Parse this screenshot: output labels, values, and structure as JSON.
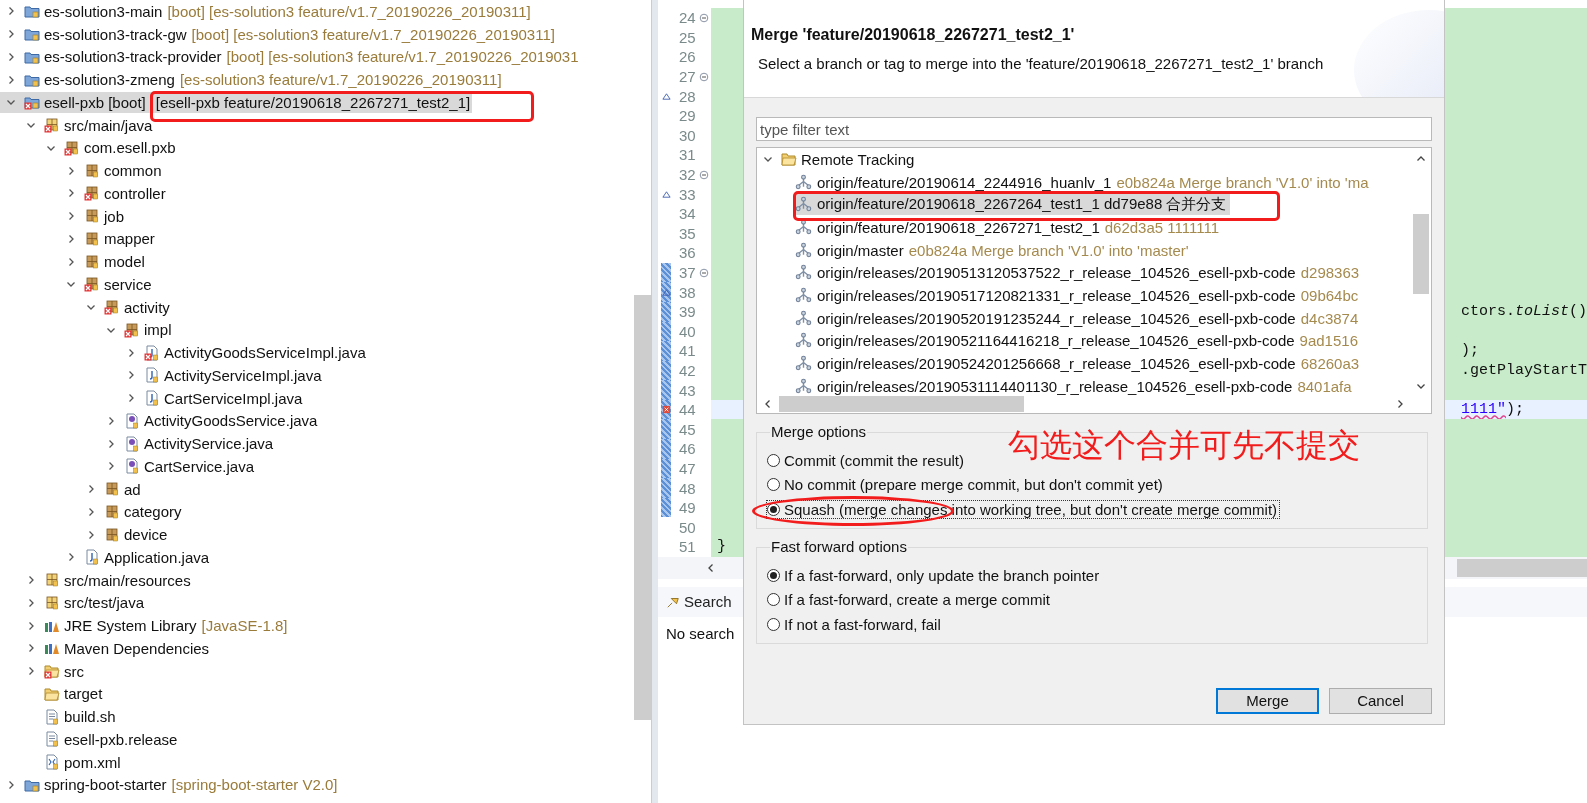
{
  "project_explorer": {
    "tree": [
      {
        "label": "es-solution3-main",
        "detail": "[boot] [es-solution3 feature/v1.7_20190226_20190311]",
        "kind": "project",
        "error": false,
        "expanded": false,
        "selected": false
      },
      {
        "label": "es-solution3-track-gw",
        "detail": "[boot] [es-solution3 feature/v1.7_20190226_20190311]",
        "kind": "project",
        "error": false,
        "expanded": false,
        "selected": false
      },
      {
        "label": "es-solution3-track-provider",
        "detail": "[boot] [es-solution3 feature/v1.7_20190226_2019031",
        "kind": "project",
        "error": false,
        "expanded": false,
        "selected": false
      },
      {
        "label": "es-solution3-zmeng",
        "detail": "[es-solution3 feature/v1.7_20190226_20190311]",
        "kind": "project",
        "error": false,
        "expanded": false,
        "selected": false
      },
      {
        "label": "esell-pxb [boot]",
        "detail": "[esell-pxb feature/20190618_2267271_test2_1]",
        "kind": "project",
        "error": true,
        "expanded": true,
        "selected": true,
        "children": [
          {
            "label": "src/main/java",
            "kind": "source-folder",
            "error": true,
            "expanded": true,
            "selected": false,
            "children": [
              {
                "label": "com.esell.pxb",
                "kind": "package",
                "error": true,
                "expanded": true,
                "selected": false,
                "children": [
                  {
                    "label": "common",
                    "kind": "package",
                    "error": false,
                    "expanded": false,
                    "selected": false
                  },
                  {
                    "label": "controller",
                    "kind": "package",
                    "error": true,
                    "expanded": false,
                    "selected": false
                  },
                  {
                    "label": "job",
                    "kind": "package",
                    "error": false,
                    "expanded": false,
                    "selected": false
                  },
                  {
                    "label": "mapper",
                    "kind": "package",
                    "error": false,
                    "expanded": false,
                    "selected": false
                  },
                  {
                    "label": "model",
                    "kind": "package",
                    "error": false,
                    "expanded": false,
                    "selected": false
                  },
                  {
                    "label": "service",
                    "kind": "package",
                    "error": true,
                    "expanded": true,
                    "selected": false,
                    "children": [
                      {
                        "label": "activity",
                        "kind": "package",
                        "error": true,
                        "expanded": true,
                        "selected": false,
                        "children": [
                          {
                            "label": "impl",
                            "kind": "package",
                            "error": true,
                            "expanded": true,
                            "selected": false,
                            "children": [
                              {
                                "label": "ActivityGoodsServiceImpl.java",
                                "kind": "java",
                                "error": true,
                                "expanded": false,
                                "selected": false
                              },
                              {
                                "label": "ActivityServiceImpl.java",
                                "kind": "java",
                                "error": false,
                                "expanded": false,
                                "selected": false
                              },
                              {
                                "label": "CartServiceImpl.java",
                                "kind": "java",
                                "error": false,
                                "expanded": false,
                                "selected": false
                              }
                            ]
                          },
                          {
                            "label": "ActivityGoodsService.java",
                            "kind": "interface",
                            "error": false,
                            "expanded": false,
                            "selected": false
                          },
                          {
                            "label": "ActivityService.java",
                            "kind": "interface",
                            "error": false,
                            "expanded": false,
                            "selected": false
                          },
                          {
                            "label": "CartService.java",
                            "kind": "interface",
                            "error": false,
                            "expanded": false,
                            "selected": false
                          }
                        ]
                      },
                      {
                        "label": "ad",
                        "kind": "package",
                        "error": false,
                        "expanded": false,
                        "selected": false
                      },
                      {
                        "label": "category",
                        "kind": "package",
                        "error": false,
                        "expanded": false,
                        "selected": false
                      },
                      {
                        "label": "device",
                        "kind": "package",
                        "error": false,
                        "expanded": false,
                        "selected": false
                      }
                    ]
                  },
                  {
                    "label": "Application.java",
                    "kind": "java",
                    "error": false,
                    "expanded": false,
                    "selected": false
                  }
                ]
              }
            ]
          },
          {
            "label": "src/main/resources",
            "kind": "source-folder",
            "error": false,
            "expanded": false,
            "selected": false
          },
          {
            "label": "src/test/java",
            "kind": "source-folder",
            "error": false,
            "expanded": false,
            "selected": false
          },
          {
            "label": "JRE System Library",
            "detail": "[JavaSE-1.8]",
            "kind": "library",
            "error": false,
            "expanded": false,
            "selected": false
          },
          {
            "label": "Maven Dependencies",
            "kind": "library",
            "error": false,
            "expanded": false,
            "selected": false
          },
          {
            "label": "src",
            "kind": "folder",
            "error": true,
            "expanded": false,
            "selected": false
          },
          {
            "label": "target",
            "kind": "folder",
            "error": false,
            "selected": false
          },
          {
            "label": "build.sh",
            "kind": "file",
            "error": false,
            "selected": false
          },
          {
            "label": "esell-pxb.release",
            "kind": "file",
            "error": false,
            "selected": false
          },
          {
            "label": "pom.xml",
            "kind": "xml",
            "error": false,
            "selected": false
          }
        ]
      },
      {
        "label": "spring-boot-starter",
        "detail": "[spring-boot-starter V2.0]",
        "kind": "project",
        "error": false,
        "expanded": false,
        "selected": false
      }
    ]
  },
  "editor": {
    "lines": [
      {
        "number": "24",
        "fold": true,
        "changed": false,
        "current": false
      },
      {
        "number": "25",
        "fold": false,
        "changed": false,
        "current": false
      },
      {
        "number": "26",
        "fold": false,
        "changed": false,
        "current": false
      },
      {
        "number": "27",
        "fold": true,
        "changed": false,
        "current": false
      },
      {
        "number": "28",
        "fold": false,
        "changed": false,
        "current": false,
        "kind": "override"
      },
      {
        "number": "29",
        "fold": false,
        "changed": false,
        "current": false
      },
      {
        "number": "30",
        "fold": false,
        "changed": false,
        "current": false
      },
      {
        "number": "31",
        "fold": false,
        "changed": false,
        "current": false
      },
      {
        "number": "32",
        "fold": true,
        "changed": false,
        "current": false
      },
      {
        "number": "33",
        "fold": false,
        "changed": false,
        "current": false,
        "kind": "override"
      },
      {
        "number": "34",
        "fold": false,
        "changed": false,
        "current": false
      },
      {
        "number": "35",
        "fold": false,
        "changed": false,
        "current": false
      },
      {
        "number": "36",
        "fold": false,
        "changed": false,
        "current": false
      },
      {
        "number": "37",
        "fold": true,
        "changed": true,
        "current": false
      },
      {
        "number": "38",
        "fold": false,
        "changed": true,
        "current": false,
        "kind": "override"
      },
      {
        "number": "39",
        "fold": false,
        "changed": true,
        "current": false,
        "tail": [
          {
            "kind": "code",
            "text": "ctors.*toList*()"
          }
        ]
      },
      {
        "number": "40",
        "fold": false,
        "changed": true,
        "current": false
      },
      {
        "number": "41",
        "fold": false,
        "changed": true,
        "current": false,
        "tail": [
          {
            "kind": "code",
            "text": ");"
          }
        ]
      },
      {
        "number": "42",
        "fold": false,
        "changed": true,
        "current": false,
        "tail": [
          {
            "kind": "code",
            "text": ".getPlayStartT"
          }
        ]
      },
      {
        "number": "43",
        "fold": false,
        "changed": true,
        "current": false
      },
      {
        "number": "44",
        "fold": false,
        "changed": true,
        "current": true,
        "kind": "error",
        "tail": [
          {
            "kind": "string",
            "text": "1111\""
          },
          {
            "kind": "code",
            "text": ");"
          }
        ]
      },
      {
        "number": "45",
        "fold": false,
        "changed": true,
        "current": false
      },
      {
        "number": "46",
        "fold": false,
        "changed": true,
        "current": false
      },
      {
        "number": "47",
        "fold": false,
        "changed": true,
        "current": false
      },
      {
        "number": "48",
        "fold": false,
        "changed": true,
        "current": false
      },
      {
        "number": "49",
        "fold": false,
        "changed": true,
        "current": false
      },
      {
        "number": "50",
        "fold": false,
        "changed": false,
        "current": false
      },
      {
        "number": "51",
        "fold": false,
        "changed": false,
        "current": false,
        "code": "}"
      }
    ]
  },
  "search_view": {
    "tab": "Search",
    "message": "No search"
  },
  "merge_dialog": {
    "title": "Merge 'feature/20190618_2267271_test2_1'",
    "message": "Select a branch or tag to merge into the 'feature/20190618_2267271_test2_1' branch",
    "filter": {
      "placeholder": "type filter text"
    },
    "refs": {
      "label": "Remote Tracking",
      "expanded": true,
      "items": [
        {
          "name": "origin/feature/20190614_2244916_huanlv_1",
          "detail": "e0b824a Merge branch 'V1.0' into 'ma",
          "selected": false
        },
        {
          "name": "origin/feature/20190618_2267264_test1_1 dd79e88 合并分支",
          "selected": true
        },
        {
          "name": "origin/feature/20190618_2267271_test2_1",
          "detail": "d62d3a5 1111111",
          "selected": false
        },
        {
          "name": "origin/master",
          "detail": "e0b824a Merge branch 'V1.0' into 'master'",
          "selected": false
        },
        {
          "name": "origin/releases/20190513120537522_r_release_104526_esell-pxb-code",
          "detail": "d298363",
          "selected": false
        },
        {
          "name": "origin/releases/20190517120821331_r_release_104526_esell-pxb-code",
          "detail": "09b64bc",
          "selected": false
        },
        {
          "name": "origin/releases/20190520191235244_r_release_104526_esell-pxb-code",
          "detail": "d4c3874",
          "selected": false
        },
        {
          "name": "origin/releases/20190521164416218_r_release_104526_esell-pxb-code",
          "detail": "9ad1516",
          "selected": false
        },
        {
          "name": "origin/releases/20190524201256668_r_release_104526_esell-pxb-code",
          "detail": "68260a3",
          "selected": false
        },
        {
          "name": "origin/releases/20190531114401130_r_release_104526_esell-pxb-code",
          "detail": "8401afa",
          "selected": false
        }
      ]
    },
    "merge_options": {
      "title": "Merge options",
      "options": [
        {
          "label": "Commit (commit the result)",
          "selected": false
        },
        {
          "label": "No commit (prepare merge commit, but don't commit yet)",
          "selected": false
        },
        {
          "label": "Squash (merge changes into working tree, but don't create merge commit)",
          "selected": true
        }
      ]
    },
    "fast_forward_options": {
      "title": "Fast forward options",
      "options": [
        {
          "label": "If a fast-forward, only update the branch pointer",
          "selected": true
        },
        {
          "label": "If a fast-forward, create a merge commit",
          "selected": false
        },
        {
          "label": "If not a fast-forward, fail",
          "selected": false
        }
      ]
    },
    "buttons": [
      {
        "label": "Merge",
        "default": true
      },
      {
        "label": "Cancel",
        "default": false
      }
    ]
  },
  "annotation": {
    "note": "勾选这个合并可先不提交"
  }
}
